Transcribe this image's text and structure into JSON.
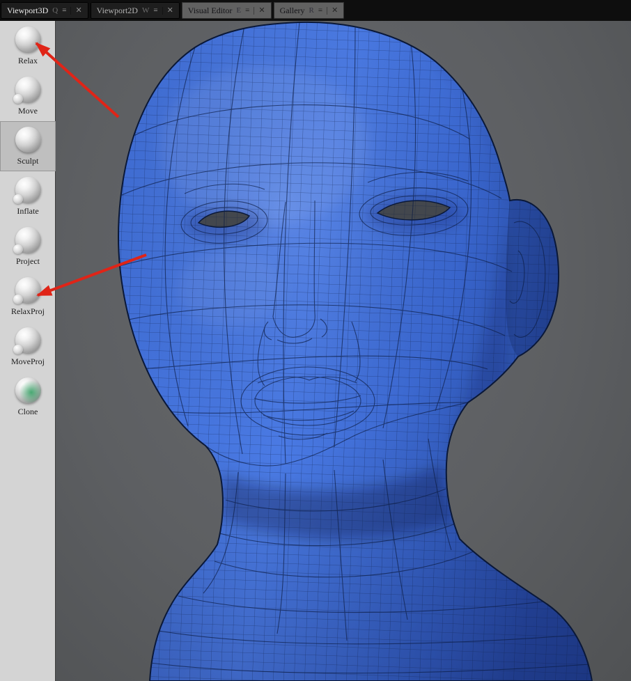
{
  "tabs": [
    {
      "label": "Viewport3D",
      "hotkey": "Q"
    },
    {
      "label": "Viewport2D",
      "hotkey": "W"
    },
    {
      "label": "Visual Editor",
      "hotkey": "E"
    },
    {
      "label": "Gallery",
      "hotkey": "R"
    }
  ],
  "tab_icons": {
    "menu": "≡",
    "close": "✕"
  },
  "tools": [
    {
      "label": "Relax"
    },
    {
      "label": "Move"
    },
    {
      "label": "Sculpt",
      "selected": true
    },
    {
      "label": "Inflate"
    },
    {
      "label": "Project"
    },
    {
      "label": "RelaxProj"
    },
    {
      "label": "MoveProj"
    },
    {
      "label": "Clone"
    }
  ],
  "viewport": {
    "content": "female head retopology wireframe mesh, three-quarter view",
    "mesh_color": "#4070da",
    "wire_color": "#0d1d44",
    "background_color": "#5d5f62"
  },
  "annotations": {
    "arrow_color": "#e02417",
    "arrows": [
      {
        "points_to": "Relax"
      },
      {
        "points_to": "RelaxProj"
      }
    ]
  }
}
